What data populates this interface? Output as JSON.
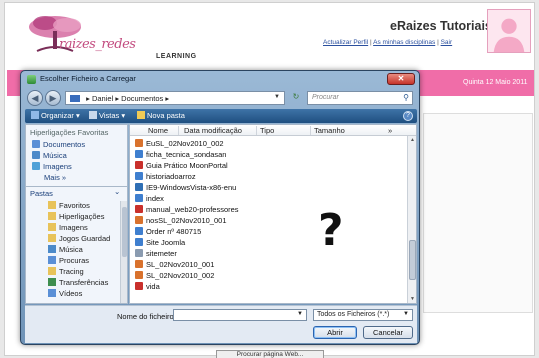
{
  "site": {
    "logo_text": "raizes_redes",
    "logo_sub": "LEARNING",
    "title": "eRaizes Tutoriais",
    "links": [
      "Actualizar Perfil",
      "As minhas disciplinas",
      "Sair"
    ],
    "separator": "|",
    "date": "Quinta 12 Maio 2011",
    "bottom_button": "Procurar página Web...",
    "accent_color": "#f06da8"
  },
  "dialog": {
    "title": "Escolher Ficheiro a Carregar",
    "close_label": "✕",
    "back_icon": "back-arrow-icon",
    "forward_icon": "forward-arrow-icon",
    "address": {
      "path": [
        "Daniel",
        "Documentos"
      ],
      "sep": "▸"
    },
    "search_placeholder": "Procurar",
    "toolbar": {
      "organize": "Organizar ▾",
      "views": "Vistas ▾",
      "new_folder": "Nova pasta"
    },
    "nav": {
      "favorites_header": "Hiperligações Favoritas",
      "favorites": [
        "Documentos",
        "Música",
        "Imagens"
      ],
      "more": "Mais »",
      "folders_header": "Pastas",
      "folders_toggle": "⌄",
      "tree": [
        "Favoritos",
        "Hiperligações",
        "Imagens",
        "Jogos Guardad",
        "Música",
        "Procuras",
        "Tracing",
        "Transferências",
        "Vídeos"
      ]
    },
    "columns": {
      "name": "Nome",
      "modified": "Data modificação",
      "type": "Tipo",
      "size": "Tamanho",
      "more": "»"
    },
    "files": [
      {
        "name": "EuSL_02Nov2010_002",
        "icon": "ppt"
      },
      {
        "name": "ficha_tecnica_sondasan",
        "icon": "web"
      },
      {
        "name": "Guia Prático MoonPortal",
        "icon": "pdf"
      },
      {
        "name": "historiadoarroz",
        "icon": "web"
      },
      {
        "name": "IE9-WindowsVista-x86-enu",
        "icon": "exe"
      },
      {
        "name": "index",
        "icon": "web"
      },
      {
        "name": "manual_web20-professores",
        "icon": "pdf"
      },
      {
        "name": "nosSL_02Nov2010_001",
        "icon": "ppt"
      },
      {
        "name": "Order nº 480715",
        "icon": "web"
      },
      {
        "name": "Site Joomla",
        "icon": "web"
      },
      {
        "name": "sitemeter",
        "icon": "txt"
      },
      {
        "name": "SL_02Nov2010_001",
        "icon": "ppt"
      },
      {
        "name": "SL_02Nov2010_002",
        "icon": "ppt"
      },
      {
        "name": "vida",
        "icon": "pdf"
      }
    ],
    "overlay_mark": "?",
    "filename_label": "Nome do ficheiro:",
    "filename_value": "",
    "filetype": "Todos os Ficheiros (*.*)",
    "open_label": "Abrir",
    "cancel_label": "Cancelar"
  }
}
